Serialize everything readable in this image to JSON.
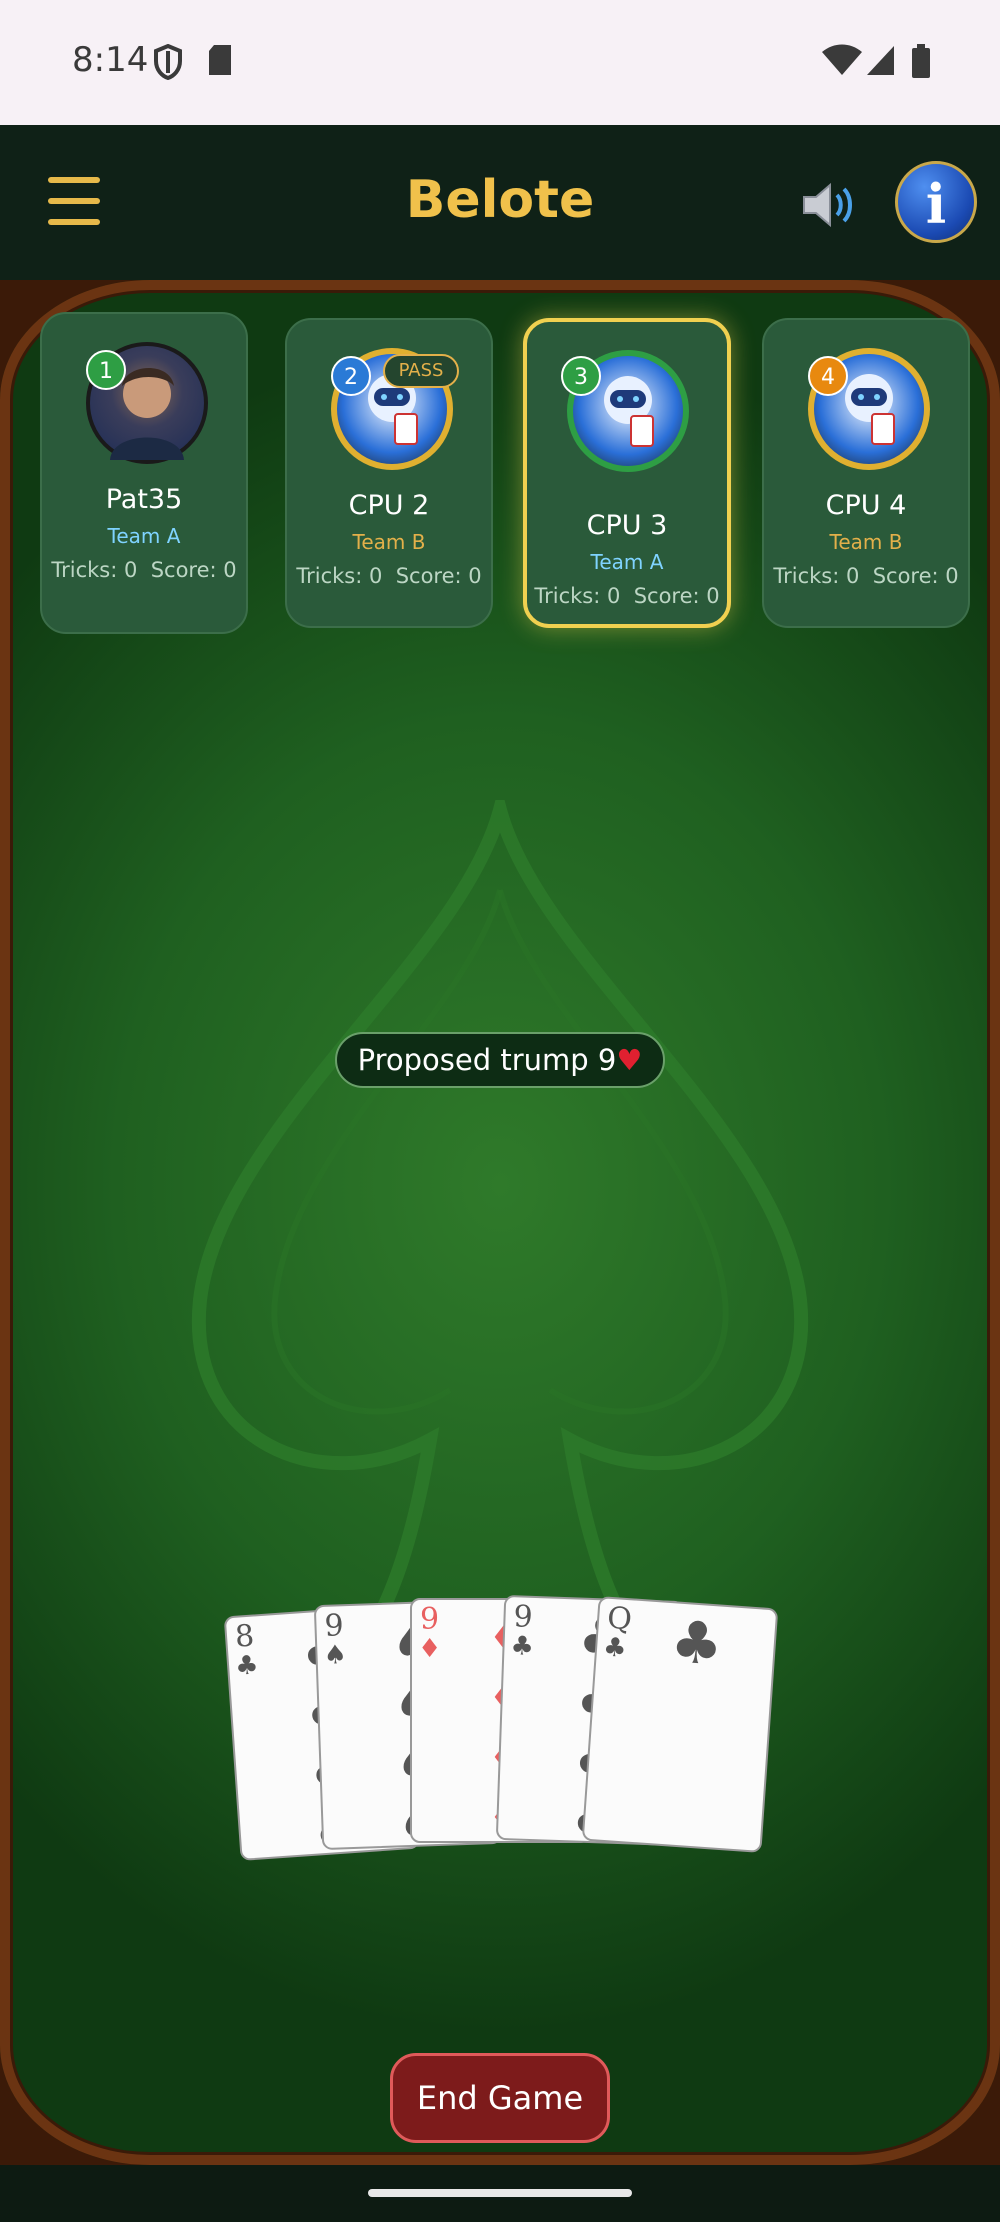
{
  "status_bar": {
    "time": "8:14",
    "icons": [
      "shield-icon",
      "sd-card-icon",
      "wifi-icon",
      "signal-icon",
      "battery-icon"
    ]
  },
  "app_bar": {
    "title": "Belote",
    "menu_icon": "hamburger-menu-icon",
    "sound_icon": "speaker-icon",
    "info_icon": "info-icon"
  },
  "players": [
    {
      "seat": "1",
      "name": "Pat35",
      "team": "Team A",
      "tricks": "Tricks: 0",
      "score": "Score: 0",
      "badge_color": "#2e9e44"
    },
    {
      "seat": "2",
      "name": "CPU 2",
      "team": "Team B",
      "tricks": "Tricks: 0",
      "score": "Score: 0",
      "badge_color": "#2a7ad6",
      "status": "PASS"
    },
    {
      "seat": "3",
      "name": "CPU 3",
      "team": "Team A",
      "tricks": "Tricks: 0",
      "score": "Score: 0",
      "badge_color": "#2e9e44",
      "active": true
    },
    {
      "seat": "4",
      "name": "CPU 4",
      "team": "Team B",
      "tricks": "Tricks: 0",
      "score": "Score: 0",
      "badge_color": "#e8890f"
    }
  ],
  "colors": {
    "team_a": "#7fd3ff",
    "team_b": "#e3b04a",
    "accent": "#f0c14b",
    "active_border": "#f0d050"
  },
  "trump": {
    "label": "Proposed trump 9",
    "suit": "♥"
  },
  "hand": [
    {
      "rank": "8",
      "suit": "♣",
      "color": "#555555"
    },
    {
      "rank": "9",
      "suit": "♠",
      "color": "#555555"
    },
    {
      "rank": "9",
      "suit": "♦",
      "color": "#e86060"
    },
    {
      "rank": "9",
      "suit": "♣",
      "color": "#555555"
    },
    {
      "rank": "Q",
      "suit": "♣",
      "color": "#555555"
    }
  ],
  "actions": {
    "end_game": "End Game"
  }
}
